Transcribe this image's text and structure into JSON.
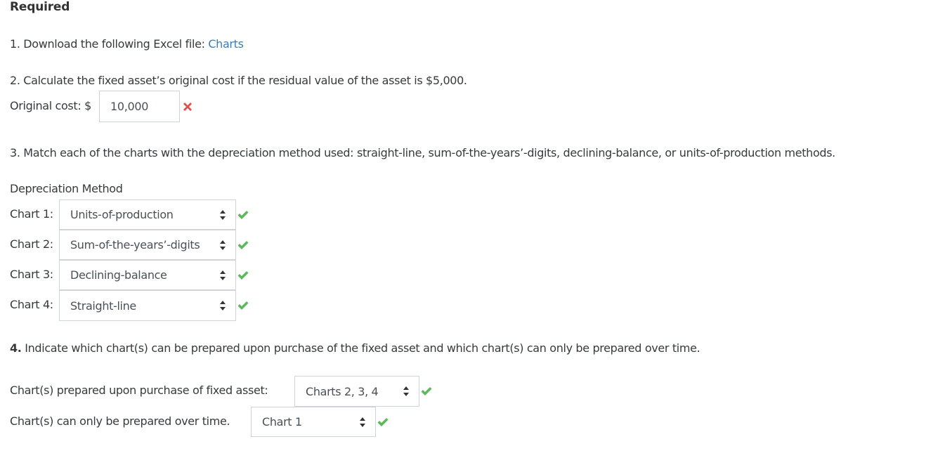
{
  "heading": "Required",
  "step1": {
    "text": "1. Download the following Excel file: ",
    "link_label": "Charts"
  },
  "step2": {
    "text": "2. Calculate the fixed asset’s original cost if the residual value of the asset is $5,000.",
    "label": "Original cost: $",
    "input_value": "10,000",
    "result_icon": "x-icon",
    "result": "incorrect"
  },
  "step3": {
    "text": "3. Match each of the charts with the depreciation method used: straight-line, sum-of-the-years’-digits, declining-balance, or units-of-production methods.",
    "column_header": "Depreciation Method",
    "rows": [
      {
        "label": "Chart 1:",
        "selected": "Units-of-production",
        "result": "correct"
      },
      {
        "label": "Chart 2:",
        "selected": "Sum-of-the-years’-digits",
        "result": "correct"
      },
      {
        "label": "Chart 3:",
        "selected": "Declining-balance",
        "result": "correct"
      },
      {
        "label": "Chart 4:",
        "selected": "Straight-line",
        "result": "correct"
      }
    ]
  },
  "step4": {
    "number": "4.",
    "text": " Indicate which chart(s) can be prepared upon purchase of the fixed asset and which chart(s) can only be prepared over time.",
    "rows": [
      {
        "label": "Chart(s) prepared upon purchase of fixed asset:",
        "selected": "Charts 2, 3, 4",
        "result": "correct"
      },
      {
        "label": "Chart(s) can only be prepared over time.",
        "selected": "Chart 1",
        "result": "correct"
      }
    ]
  },
  "colors": {
    "link": "#3a7db5",
    "correct": "#5cb85c",
    "incorrect": "#d9534f",
    "text": "#373a3c",
    "border": "#ced4da"
  }
}
